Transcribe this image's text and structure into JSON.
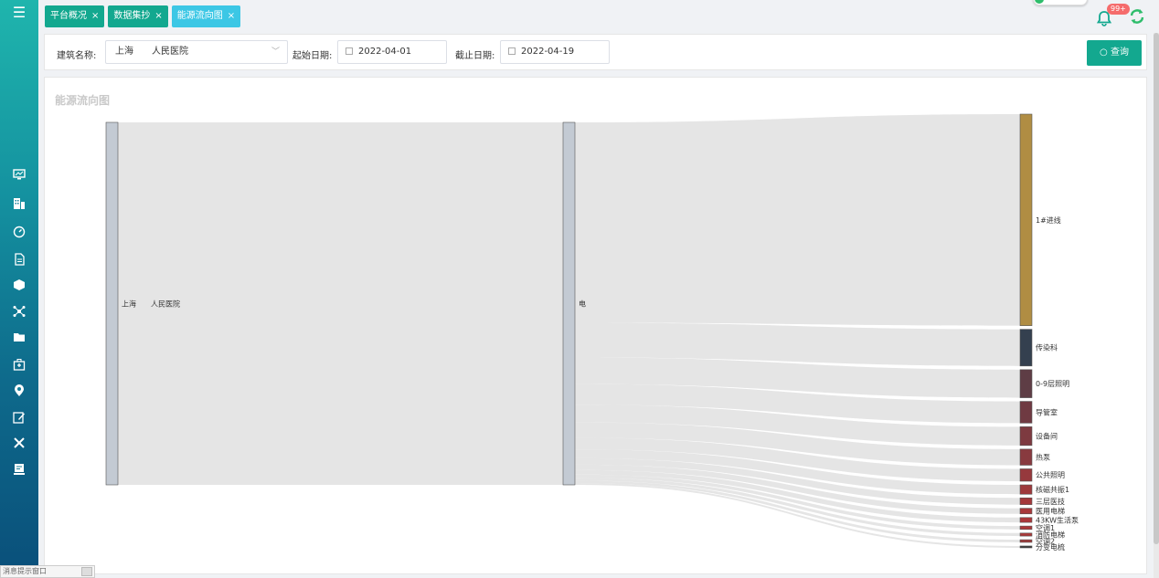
{
  "tabs": [
    {
      "label": "平台概况",
      "close": "×"
    },
    {
      "label": "数据集抄",
      "close": "×"
    },
    {
      "label": "能源流向图",
      "close": "×"
    }
  ],
  "notification_badge": "99+",
  "filter": {
    "building_label": "建筑名称:",
    "building_value": "上海　　人民医院",
    "start_label": "起始日期:",
    "start_value": "2022-04-01",
    "end_label": "截止日期:",
    "end_value": "2022-04-19",
    "query_button": "查询"
  },
  "panel_title": "能源流向图",
  "chart_data": {
    "type": "sankey",
    "nodes": [
      "上海　　人民医院",
      "电",
      "1#进线",
      "传染科",
      "0-9层照明",
      "导管室",
      "设备间",
      "热泵",
      "公共照明",
      "核磁共振1",
      "三层医技",
      "医用电梯",
      "43KW生活泵",
      "空调1",
      "消防电梯",
      "空调2",
      "分变电梳"
    ],
    "links": [
      {
        "source": "上海　　人民医院",
        "target": "电",
        "value": 100
      },
      {
        "source": "电",
        "target": "1#进线",
        "value": 56.5
      },
      {
        "source": "电",
        "target": "传染科",
        "value": 9.8
      },
      {
        "source": "电",
        "target": "0-9层照明",
        "value": 7.5
      },
      {
        "source": "电",
        "target": "导管室",
        "value": 5.8
      },
      {
        "source": "电",
        "target": "设备间",
        "value": 5.0
      },
      {
        "source": "电",
        "target": "热泵",
        "value": 4.3
      },
      {
        "source": "电",
        "target": "公共照明",
        "value": 3.3
      },
      {
        "source": "电",
        "target": "核磁共振1",
        "value": 2.5
      },
      {
        "source": "电",
        "target": "三层医技",
        "value": 1.8
      },
      {
        "source": "电",
        "target": "医用电梯",
        "value": 1.5
      },
      {
        "source": "电",
        "target": "43KW生活泵",
        "value": 1.3
      },
      {
        "source": "电",
        "target": "空调1",
        "value": 0.9
      },
      {
        "source": "电",
        "target": "消防电梯",
        "value": 0.8
      },
      {
        "source": "电",
        "target": "空调2",
        "value": 0.7
      },
      {
        "source": "电",
        "target": "分变电梳",
        "value": 0.5
      }
    ],
    "colors": {
      "上海　　人民医院": "#c3cad3",
      "电": "#c3cad3",
      "1#进线": "#b08d43",
      "传染科": "#34404f",
      "0-9层照明": "#5e3d45",
      "导管室": "#6f3a42",
      "设备间": "#7d3a40",
      "热泵": "#883a3f",
      "公共照明": "#96393d",
      "核磁共振1": "#9e393c",
      "三层医技": "#a4383b",
      "医用电梯": "#a8383b",
      "43KW生活泵": "#ab373a",
      "空调1": "#ad3739",
      "消防电梯": "#a83a3a",
      "空调2": "#9e3838",
      "分变电梳": "#3a3a3a"
    },
    "link_color": "#dcdcdc"
  },
  "status_window": "消息提示窗口",
  "sidebar_icons": [
    "monitor-icon",
    "building-icon",
    "gauge-icon",
    "document-icon",
    "cube-icon",
    "network-icon",
    "folder-icon",
    "hospital-icon",
    "location-icon",
    "edit-icon",
    "tools-icon",
    "report-icon"
  ]
}
